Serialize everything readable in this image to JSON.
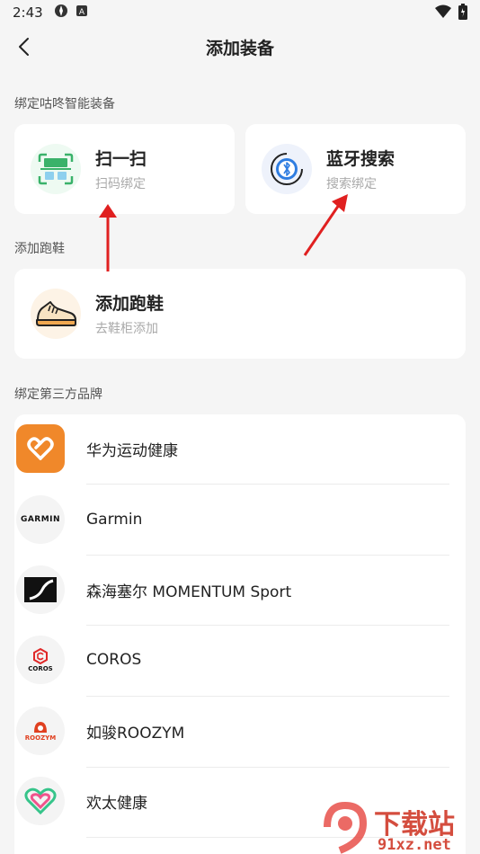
{
  "status_bar": {
    "time": "2:43"
  },
  "header": {
    "title": "添加装备"
  },
  "section_smart": {
    "label": "绑定咕咚智能装备",
    "scan": {
      "title": "扫一扫",
      "subtitle": "扫码绑定"
    },
    "bluetooth": {
      "title": "蓝牙搜索",
      "subtitle": "搜索绑定"
    }
  },
  "section_shoes": {
    "label": "添加跑鞋",
    "shoe": {
      "title": "添加跑鞋",
      "subtitle": "去鞋柜添加"
    }
  },
  "section_brands": {
    "label": "绑定第三方品牌",
    "items": [
      {
        "name": "华为运动健康"
      },
      {
        "name": "Garmin",
        "logo_text": "GARMIN"
      },
      {
        "name": "森海塞尔 MOMENTUM Sport"
      },
      {
        "name": "COROS",
        "logo_text": "COROS"
      },
      {
        "name": "如骏ROOZYM",
        "logo_text": "ROOZYM"
      },
      {
        "name": "欢太健康"
      }
    ]
  },
  "watermark": {
    "text_cn": "下载站",
    "text_url": "91xz.net"
  },
  "colors": {
    "accent_red": "#e02020",
    "huawei_orange": "#f0882a",
    "bluetooth_blue": "#2f7de1"
  }
}
